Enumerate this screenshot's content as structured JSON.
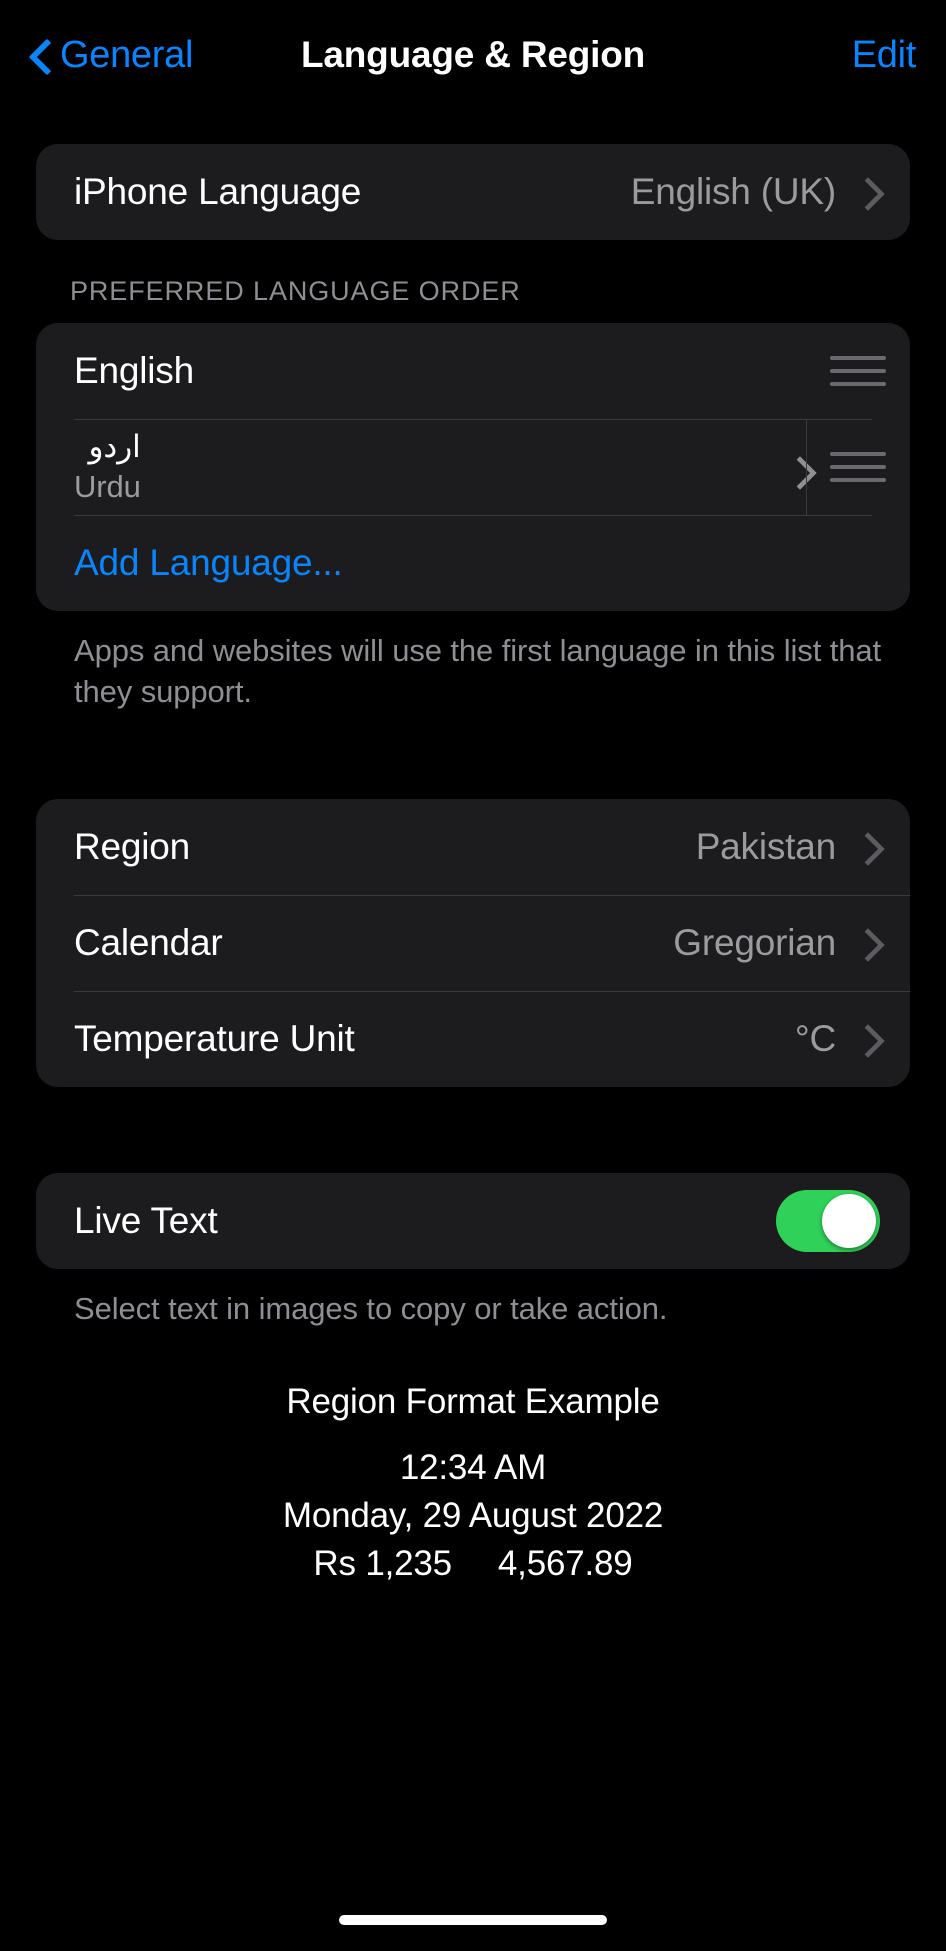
{
  "nav": {
    "back_label": "General",
    "title": "Language & Region",
    "edit_label": "Edit"
  },
  "phone_language": {
    "label": "iPhone Language",
    "value": "English (UK)"
  },
  "language_order": {
    "header": "PREFERRED LANGUAGE ORDER",
    "items": [
      {
        "native": "English",
        "sub": "",
        "has_chevron": false,
        "has_divider": false
      },
      {
        "native": "اردو",
        "sub": "Urdu",
        "has_chevron": true,
        "has_divider": true
      }
    ],
    "add_label": "Add Language...",
    "footer": "Apps and websites will use the first language in this list that they support."
  },
  "region_section": {
    "rows": [
      {
        "label": "Region",
        "value": "Pakistan"
      },
      {
        "label": "Calendar",
        "value": "Gregorian"
      },
      {
        "label": "Temperature Unit",
        "value": "°C"
      }
    ]
  },
  "live_text": {
    "label": "Live Text",
    "enabled": true,
    "footer": "Select text in images to copy or take action."
  },
  "region_example": {
    "title": "Region Format Example",
    "time": "12:34 AM",
    "date": "Monday, 29 August 2022",
    "currency": "Rs 1,235",
    "number": "4,567.89"
  },
  "colors": {
    "accent": "#0a84ff",
    "toggle_on": "#30d158",
    "card": "#1c1c1e",
    "background": "#000000",
    "secondary_text": "#8e8e93"
  }
}
